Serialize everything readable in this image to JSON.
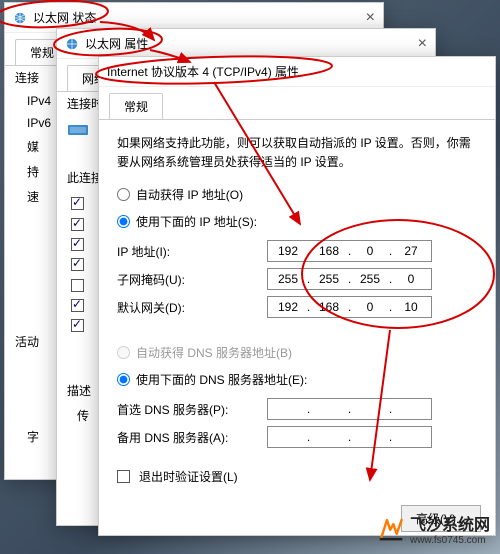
{
  "dialog_status": {
    "title": "以太网 状态",
    "tab": "常规",
    "labels": {
      "connection": "连接",
      "ipv4": "IPv4",
      "ipv6": "IPv6",
      "media": "媒",
      "duration": "持",
      "speed": "速",
      "activity": "活动",
      "bytes": "字"
    }
  },
  "dialog_properties": {
    "title": "以太网 属性",
    "tab": "网络",
    "connect_using": "连接时",
    "this_connection": "此连接",
    "describe": "描述",
    "transfer": "传"
  },
  "dialog_ipv4": {
    "title": "Internet 协议版本 4 (TCP/IPv4) 属性",
    "tab": "常规",
    "description": "如果网络支持此功能，则可以获取自动指派的 IP 设置。否则，你需要从网络系统管理员处获得适当的 IP 设置。",
    "radio_auto_ip": "自动获得 IP 地址(O)",
    "radio_manual_ip": "使用下面的 IP 地址(S):",
    "label_ip": "IP 地址(I):",
    "label_mask": "子网掩码(U):",
    "label_gateway": "默认网关(D):",
    "ip": {
      "a": "192",
      "b": "168",
      "c": "0",
      "d": "27"
    },
    "mask": {
      "a": "255",
      "b": "255",
      "c": "255",
      "d": "0"
    },
    "gateway": {
      "a": "192",
      "b": "168",
      "c": "0",
      "d": "10"
    },
    "radio_auto_dns": "自动获得 DNS 服务器地址(B)",
    "radio_manual_dns": "使用下面的 DNS 服务器地址(E):",
    "label_dns1": "首选 DNS 服务器(P):",
    "label_dns2": "备用 DNS 服务器(A):",
    "exit_validate": "退出时验证设置(L)",
    "btn_advanced": "高级(V)..."
  },
  "watermark": {
    "name": "飞沙系统网",
    "url": "www.fs0745.com"
  }
}
